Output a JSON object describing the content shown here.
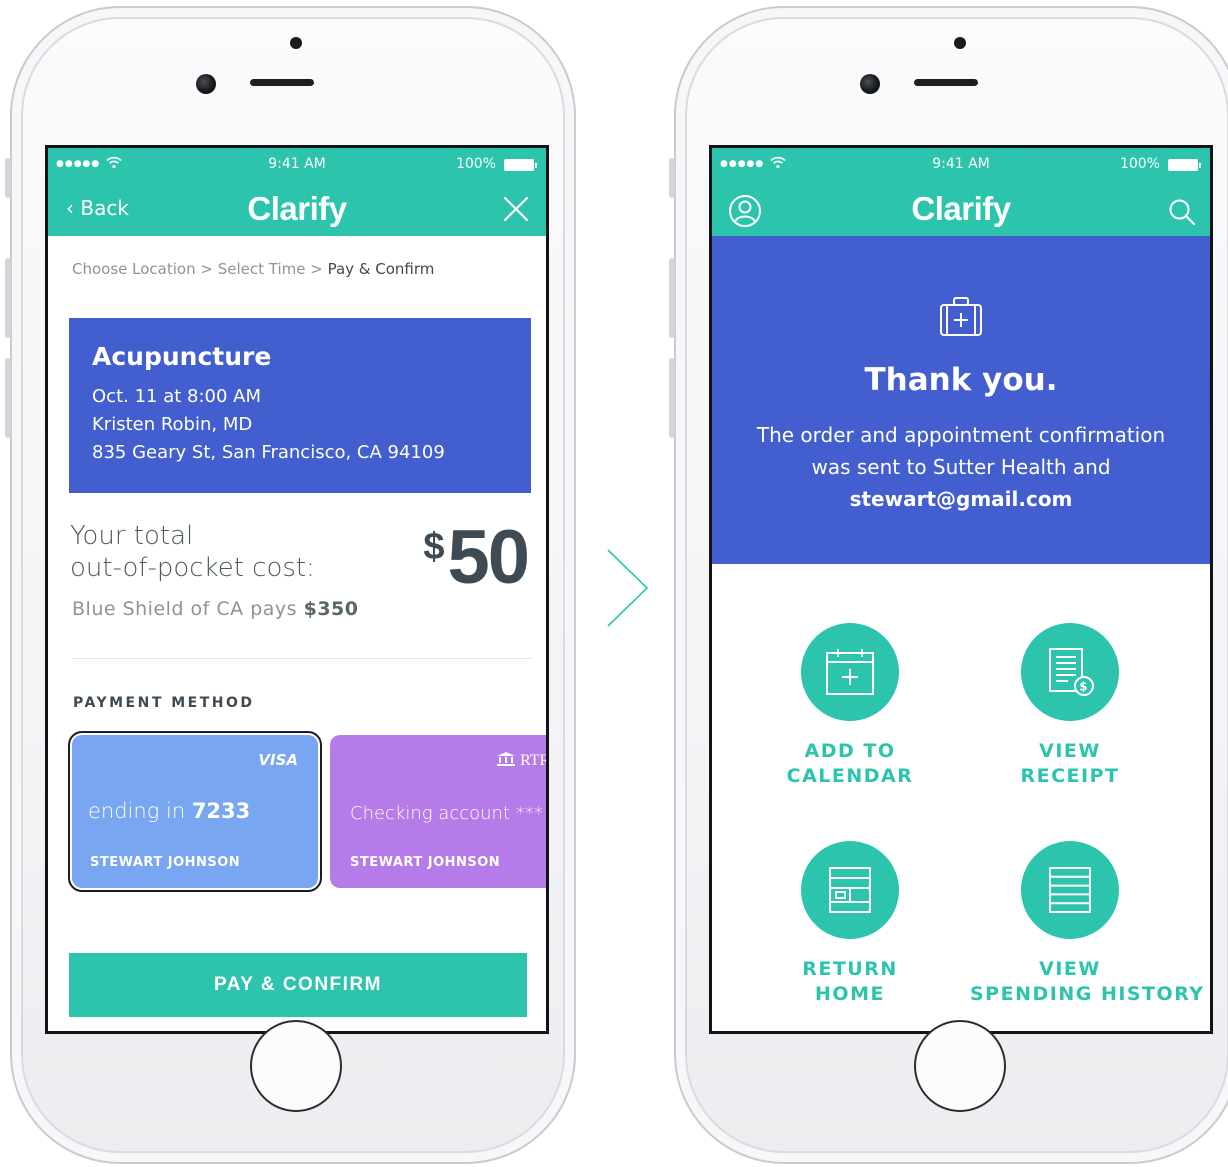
{
  "left_screen": {
    "status": {
      "signal": "●●●●●",
      "wifi": "wifi-icon",
      "time": "9:41 AM",
      "battery": "100%"
    },
    "nav": {
      "back_label": "‹ Back",
      "logo": "Clarify",
      "close_icon": "close-icon"
    },
    "breadcrumb": {
      "step1": "Choose Location",
      "sep1": " > ",
      "step2": "Select Time",
      "sep2": " > ",
      "step3": "Pay & Confirm"
    },
    "appointment": {
      "service": "Acupuncture",
      "datetime": "Oct. 11 at 8:00 AM",
      "provider": "Kristen Robin, MD",
      "address": "835 Geary St, San Francisco, CA 94109"
    },
    "cost": {
      "label_line1": "Your total",
      "label_line2": "out-of-pocket cost:",
      "currency": "$",
      "amount": "50",
      "payer_text": "Blue Shield of CA pays",
      "payer_amount": "$350"
    },
    "payment": {
      "section_label": "PAYMENT METHOD",
      "cards": [
        {
          "brand": "VISA",
          "ending_label": "ending in",
          "ending_digits": "7233",
          "holder": "STEWART JOHNSON",
          "selected": true,
          "color": "#79a6f0"
        },
        {
          "brand": "RTR Ban",
          "ending_label": "Checking account ***",
          "ending_digits": "",
          "holder": "STEWART JOHNSON",
          "selected": false,
          "color": "#b57be8"
        }
      ]
    },
    "pay_button": "PAY & CONFIRM"
  },
  "right_screen": {
    "status": {
      "signal": "●●●●●",
      "wifi": "wifi-icon",
      "time": "9:41 AM",
      "battery": "100%"
    },
    "nav": {
      "logo": "Clarify",
      "profile_icon": "profile-icon",
      "search_icon": "search-icon"
    },
    "confirmation": {
      "icon": "medical-kit-icon",
      "title": "Thank you.",
      "message_part1": "The order and appointment confirmation was sent to Sutter Health and ",
      "email": "stewart@gmail.com"
    },
    "actions": [
      {
        "icon": "calendar-add-icon",
        "line1": "ADD TO",
        "line2": "CALENDAR"
      },
      {
        "icon": "receipt-icon",
        "line1": "VIEW",
        "line2": "RECEIPT"
      },
      {
        "icon": "home-layout-icon",
        "line1": "RETURN",
        "line2": "HOME"
      },
      {
        "icon": "list-icon",
        "line1": "VIEW",
        "line2": "SPENDING HISTORY"
      }
    ]
  },
  "colors": {
    "teal": "#2cc4ad",
    "blue": "#425ecf",
    "visa_card": "#79a6f0",
    "bank_card": "#b57be8",
    "text": "#3f4a52"
  }
}
